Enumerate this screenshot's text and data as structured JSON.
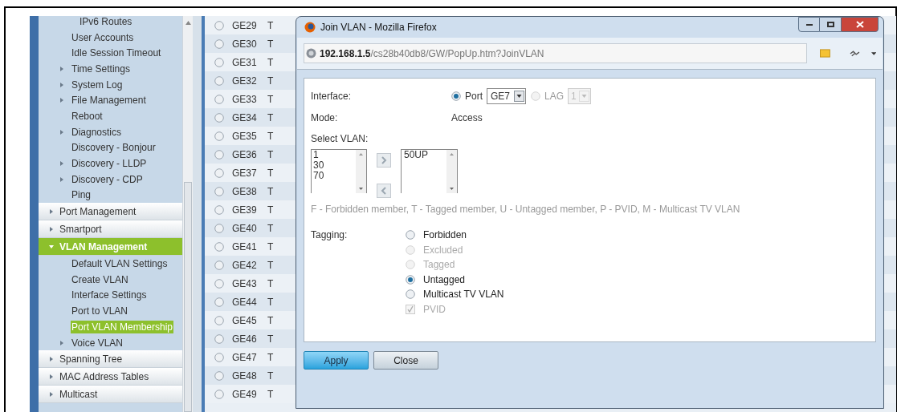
{
  "sidebar": {
    "items": [
      {
        "label": "IPv6 Routes",
        "kind": "sublink",
        "selected": false
      },
      {
        "label": "User Accounts",
        "kind": "link",
        "selected": false
      },
      {
        "label": "Idle Session Timeout",
        "kind": "link",
        "selected": false
      },
      {
        "label": "Time Settings",
        "kind": "group",
        "selected": false
      },
      {
        "label": "System Log",
        "kind": "group",
        "selected": false
      },
      {
        "label": "File Management",
        "kind": "group",
        "selected": false
      },
      {
        "label": "Reboot",
        "kind": "link",
        "selected": false
      },
      {
        "label": "Diagnostics",
        "kind": "group",
        "selected": false
      },
      {
        "label": "Discovery - Bonjour",
        "kind": "link",
        "selected": false
      },
      {
        "label": "Discovery - LLDP",
        "kind": "group",
        "selected": false
      },
      {
        "label": "Discovery - CDP",
        "kind": "group",
        "selected": false
      },
      {
        "label": "Ping",
        "kind": "link",
        "selected": false
      },
      {
        "label": "Port Management",
        "kind": "section",
        "expanded": false
      },
      {
        "label": "Smartport",
        "kind": "section",
        "expanded": false
      },
      {
        "label": "VLAN Management",
        "kind": "section",
        "expanded": true,
        "children": [
          {
            "label": "Default VLAN Settings",
            "kind": "link",
            "selected": false
          },
          {
            "label": "Create VLAN",
            "kind": "link",
            "selected": false
          },
          {
            "label": "Interface Settings",
            "kind": "link",
            "selected": false
          },
          {
            "label": "Port to VLAN",
            "kind": "link",
            "selected": false
          },
          {
            "label": "Port VLAN Membership",
            "kind": "link",
            "selected": true
          },
          {
            "label": "Voice VLAN",
            "kind": "group",
            "selected": false
          }
        ]
      },
      {
        "label": "Spanning Tree",
        "kind": "section",
        "expanded": false
      },
      {
        "label": "MAC Address Tables",
        "kind": "section",
        "expanded": false
      },
      {
        "label": "Multicast",
        "kind": "section",
        "expanded": false
      }
    ]
  },
  "port_table": {
    "rows": [
      {
        "port": "GE29",
        "column_3": "T",
        "selected": false
      },
      {
        "port": "GE30",
        "column_3": "T",
        "selected": false
      },
      {
        "port": "GE31",
        "column_3": "T",
        "selected": false
      },
      {
        "port": "GE32",
        "column_3": "T",
        "selected": false
      },
      {
        "port": "GE33",
        "column_3": "T",
        "selected": false
      },
      {
        "port": "GE34",
        "column_3": "T",
        "selected": false
      },
      {
        "port": "GE35",
        "column_3": "T",
        "selected": false
      },
      {
        "port": "GE36",
        "column_3": "T",
        "selected": false
      },
      {
        "port": "GE37",
        "column_3": "T",
        "selected": false
      },
      {
        "port": "GE38",
        "column_3": "T",
        "selected": false
      },
      {
        "port": "GE39",
        "column_3": "T",
        "selected": false
      },
      {
        "port": "GE40",
        "column_3": "T",
        "selected": false
      },
      {
        "port": "GE41",
        "column_3": "T",
        "selected": false
      },
      {
        "port": "GE42",
        "column_3": "T",
        "selected": false
      },
      {
        "port": "GE43",
        "column_3": "T",
        "selected": false
      },
      {
        "port": "GE44",
        "column_3": "T",
        "selected": false
      },
      {
        "port": "GE45",
        "column_3": "T",
        "selected": false
      },
      {
        "port": "GE46",
        "column_3": "T",
        "selected": false
      },
      {
        "port": "GE47",
        "column_3": "T",
        "selected": false
      },
      {
        "port": "GE48",
        "column_3": "T",
        "selected": false
      },
      {
        "port": "GE49",
        "column_3": "T",
        "selected": false
      }
    ]
  },
  "popup": {
    "title": "Join VLAN - Mozilla Firefox",
    "url": {
      "host": "192.168.1.5",
      "path": "/cs28b40db8/GW/PopUp.htm?JoinVLAN"
    },
    "interface": {
      "label": "Interface:",
      "options": [
        {
          "label": "Port",
          "value": "GE7",
          "selected": true,
          "disabled": false
        },
        {
          "label": "LAG",
          "value": "1",
          "selected": false,
          "disabled": true
        }
      ]
    },
    "mode": {
      "label": "Mode:",
      "value": "Access"
    },
    "select_vlan": {
      "label": "Select VLAN:",
      "available": [
        "1",
        "30",
        "70"
      ],
      "members": [
        "50UP"
      ]
    },
    "legend": "F - Forbidden member, T - Tagged member, U - Untagged member, P - PVID, M - Multicast TV VLAN",
    "tagging": {
      "label": "Tagging:",
      "options": [
        {
          "label": "Forbidden",
          "selected": false,
          "disabled": false
        },
        {
          "label": "Excluded",
          "selected": false,
          "disabled": true
        },
        {
          "label": "Tagged",
          "selected": false,
          "disabled": true
        },
        {
          "label": "Untagged",
          "selected": true,
          "disabled": false
        },
        {
          "label": "Multicast TV VLAN",
          "selected": false,
          "disabled": false
        }
      ]
    },
    "pvid": {
      "label": "PVID",
      "checked": true,
      "disabled": true
    },
    "buttons": [
      {
        "label": "Apply",
        "kind": "primary"
      },
      {
        "label": "Close",
        "kind": "secondary"
      }
    ]
  }
}
